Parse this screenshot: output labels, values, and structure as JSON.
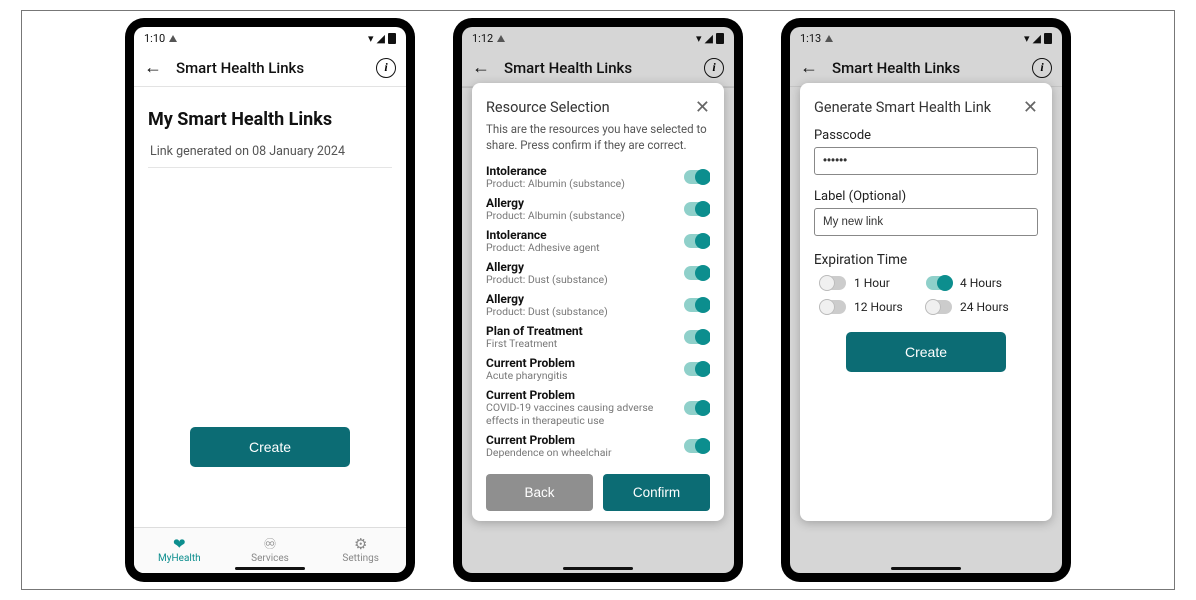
{
  "colors": {
    "accent": "#0c6c74",
    "accent_light": "#0c8e8e"
  },
  "nav": {
    "items": [
      {
        "label": "MyHealth",
        "icon": "heart-hand",
        "active": true
      },
      {
        "label": "Services",
        "icon": "stethoscope",
        "active": false
      },
      {
        "label": "Settings",
        "icon": "gear",
        "active": false
      }
    ]
  },
  "screens": [
    {
      "status_time": "1:10",
      "header_title": "Smart Health Links",
      "page_title": "My Smart Health Links",
      "link_generated_text": "Link generated on 08 January 2024",
      "create_label": "Create"
    },
    {
      "status_time": "1:12",
      "header_title": "Smart Health Links",
      "modal": {
        "title": "Resource Selection",
        "subtitle": "This are the resources you have selected to share. Press confirm if they are correct.",
        "back_label": "Back",
        "confirm_label": "Confirm",
        "resources": [
          {
            "title": "Intolerance",
            "subtitle": "Product: Albumin (substance)",
            "on": true
          },
          {
            "title": "Allergy",
            "subtitle": "Product: Albumin (substance)",
            "on": true
          },
          {
            "title": "Intolerance",
            "subtitle": "Product: Adhesive agent",
            "on": true
          },
          {
            "title": "Allergy",
            "subtitle": "Product: Dust (substance)",
            "on": true
          },
          {
            "title": "Allergy",
            "subtitle": "Product: Dust (substance)",
            "on": true
          },
          {
            "title": "Plan of Treatment",
            "subtitle": "First Treatment",
            "on": true
          },
          {
            "title": "Current Problem",
            "subtitle": "Acute pharyngitis",
            "on": true
          },
          {
            "title": "Current Problem",
            "subtitle": "COVID-19 vaccines causing adverse effects in therapeutic use",
            "on": true
          },
          {
            "title": "Current Problem",
            "subtitle": "Dependence on wheelchair",
            "on": true
          }
        ]
      }
    },
    {
      "status_time": "1:13",
      "header_title": "Smart Health Links",
      "modal": {
        "title": "Generate Smart Health Link",
        "passcode_label": "Passcode",
        "passcode_value": "••••••",
        "label_label": "Label (Optional)",
        "label_value": "My new link",
        "expiration_label": "Expiration Time",
        "expiration_options": [
          {
            "label": "1 Hour",
            "on": false
          },
          {
            "label": "4 Hours",
            "on": true
          },
          {
            "label": "12 Hours",
            "on": false
          },
          {
            "label": "24 Hours",
            "on": false
          }
        ],
        "create_label": "Create"
      }
    }
  ]
}
